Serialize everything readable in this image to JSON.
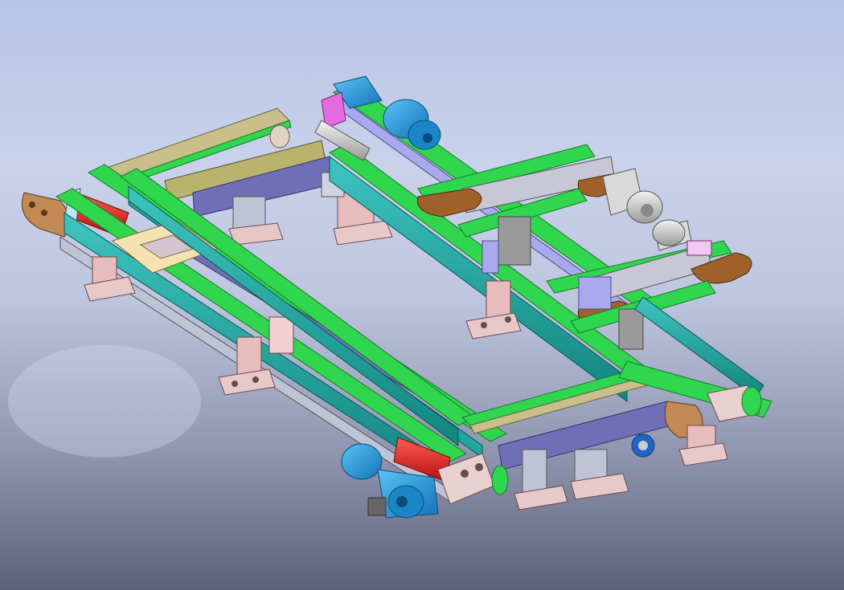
{
  "app": {
    "kind": "CAD 3D graphics area"
  },
  "model": {
    "name": ""
  },
  "colors": {
    "frame": "#1fa3a0",
    "belt": "#2fd64e",
    "motor": "#1e9be0",
    "bracket": "#c8a8a8",
    "roller_red": "#e8201c",
    "pulley": "#a0602a",
    "plate": "#a9a9ee",
    "pink": "#e46ae0"
  }
}
